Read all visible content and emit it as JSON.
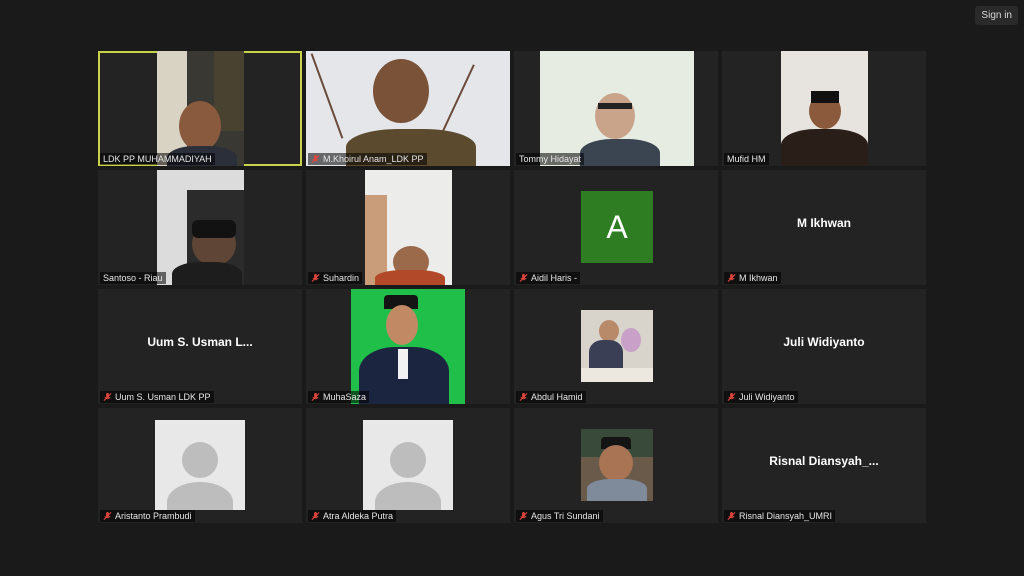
{
  "top_bar": {
    "sign_in": "Sign in"
  },
  "participants": [
    {
      "name": "LDK PP MUHAMMADIYAH",
      "muted": false
    },
    {
      "name": "M.Khoirul Anam_LDK PP",
      "muted": true
    },
    {
      "name": "Tommy Hidayat",
      "muted": false
    },
    {
      "name": "Mufid HM",
      "muted": false
    },
    {
      "name": "Santoso -  Riau",
      "muted": false
    },
    {
      "name": "Suhardin",
      "muted": true
    },
    {
      "name": "Aidil Haris -",
      "muted": true,
      "avatar_letter": "A"
    },
    {
      "name": "M Ikhwan",
      "muted": true,
      "display_name": "M Ikhwan"
    },
    {
      "name": "Uum S. Usman LDK PP",
      "muted": true,
      "display_name": "Uum S. Usman L..."
    },
    {
      "name": "MuhaSaza",
      "muted": true
    },
    {
      "name": "Abdul Hamid",
      "muted": true
    },
    {
      "name": "Juli Widiyanto",
      "muted": true,
      "display_name": "Juli Widiyanto"
    },
    {
      "name": "Aristanto Prambudi",
      "muted": true
    },
    {
      "name": "Atra Aldeka Putra",
      "muted": true
    },
    {
      "name": "Agus Tri Sundani",
      "muted": true
    },
    {
      "name": "Risnal Diansyah_UMRI",
      "muted": true,
      "display_name": "Risnal  Diansyah_..."
    }
  ],
  "colors": {
    "active_speaker_border": "#c7d44a",
    "mic_off": "#e0463c",
    "avatar_green": "#2e7d23"
  }
}
